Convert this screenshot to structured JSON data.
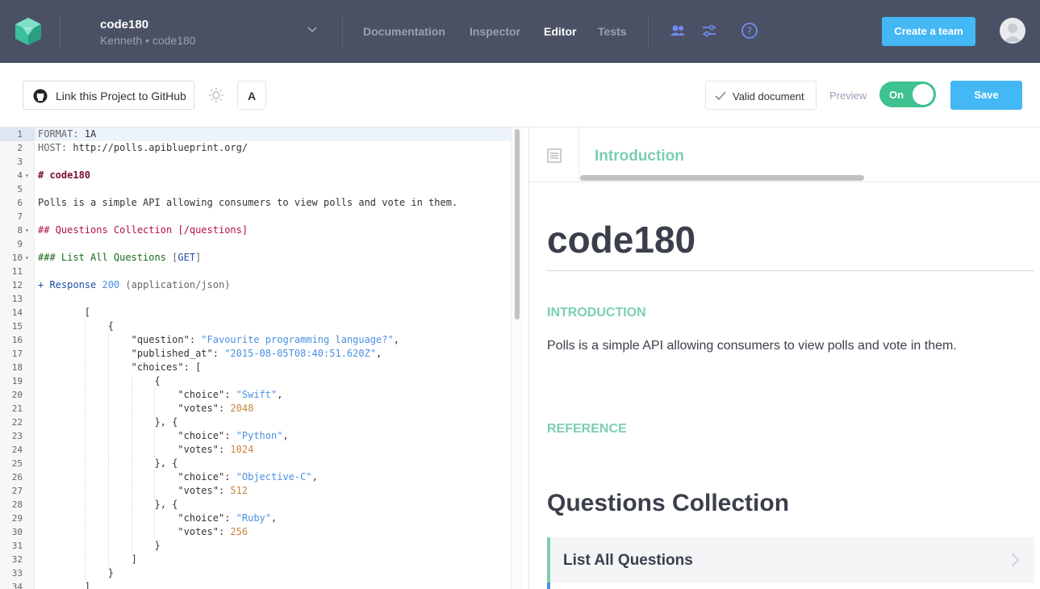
{
  "header": {
    "project_name": "code180",
    "project_sub": "Kenneth • code180",
    "nav": [
      "Documentation",
      "Inspector",
      "Editor",
      "Tests"
    ],
    "active_nav": "Editor",
    "create_team_label": "Create a team",
    "icons": [
      "team-icon",
      "settings-sliders-icon",
      "help-icon"
    ]
  },
  "toolbar": {
    "github_label": "Link this Project to GitHub",
    "font_label": "A",
    "valid_label": "Valid document",
    "preview_label": "Preview",
    "toggle_label": "On",
    "save_label": "Save"
  },
  "editor": {
    "lines": [
      {
        "n": "1",
        "fold": "",
        "parts": [
          [
            "c-gray",
            "FORMAT: "
          ],
          [
            "c-plain",
            "1A"
          ]
        ]
      },
      {
        "n": "2",
        "fold": "",
        "parts": [
          [
            "c-gray",
            "HOST: "
          ],
          [
            "c-plain",
            "http://polls.apiblueprint.org/"
          ]
        ]
      },
      {
        "n": "3",
        "fold": "",
        "parts": []
      },
      {
        "n": "4",
        "fold": "▾",
        "parts": [
          [
            "c-h1",
            "# code180"
          ]
        ]
      },
      {
        "n": "5",
        "fold": "",
        "parts": []
      },
      {
        "n": "6",
        "fold": "",
        "parts": [
          [
            "c-plain",
            "Polls is a simple API allowing consumers to view polls and vote in them."
          ]
        ]
      },
      {
        "n": "7",
        "fold": "",
        "parts": []
      },
      {
        "n": "8",
        "fold": "▾",
        "parts": [
          [
            "c-h2",
            "## Questions Collection "
          ],
          [
            "c-h2",
            "[/questions]"
          ]
        ]
      },
      {
        "n": "9",
        "fold": "",
        "parts": []
      },
      {
        "n": "10",
        "fold": "▾",
        "parts": [
          [
            "c-h3",
            "### List All Questions "
          ],
          [
            "c-gray",
            "["
          ],
          [
            "c-res",
            "GET"
          ],
          [
            "c-gray",
            "]"
          ]
        ]
      },
      {
        "n": "11",
        "fold": "",
        "parts": []
      },
      {
        "n": "12",
        "fold": "",
        "parts": [
          [
            "c-res",
            "+ Response "
          ],
          [
            "c-str",
            "200"
          ],
          [
            "c-gray",
            " (application/json)"
          ]
        ]
      },
      {
        "n": "13",
        "fold": "",
        "parts": []
      },
      {
        "n": "14",
        "fold": "",
        "parts": [
          [
            "c-plain",
            "        ["
          ]
        ]
      },
      {
        "n": "15",
        "fold": "",
        "parts": [
          [
            "c-plain",
            "            {"
          ]
        ]
      },
      {
        "n": "16",
        "fold": "",
        "parts": [
          [
            "c-key",
            "                \"question\": "
          ],
          [
            "c-str",
            "\"Favourite programming language?\""
          ],
          [
            "c-plain",
            ","
          ]
        ]
      },
      {
        "n": "17",
        "fold": "",
        "parts": [
          [
            "c-key",
            "                \"published_at\": "
          ],
          [
            "c-str",
            "\"2015-08-05T08:40:51.620Z\""
          ],
          [
            "c-plain",
            ","
          ]
        ]
      },
      {
        "n": "18",
        "fold": "",
        "parts": [
          [
            "c-key",
            "                \"choices\": ["
          ]
        ]
      },
      {
        "n": "19",
        "fold": "",
        "parts": [
          [
            "c-plain",
            "                    {"
          ]
        ]
      },
      {
        "n": "20",
        "fold": "",
        "parts": [
          [
            "c-key",
            "                        \"choice\": "
          ],
          [
            "c-str",
            "\"Swift\""
          ],
          [
            "c-plain",
            ","
          ]
        ]
      },
      {
        "n": "21",
        "fold": "",
        "parts": [
          [
            "c-key",
            "                        \"votes\": "
          ],
          [
            "c-num",
            "2048"
          ]
        ]
      },
      {
        "n": "22",
        "fold": "",
        "parts": [
          [
            "c-plain",
            "                    }, {"
          ]
        ]
      },
      {
        "n": "23",
        "fold": "",
        "parts": [
          [
            "c-key",
            "                        \"choice\": "
          ],
          [
            "c-str",
            "\"Python\""
          ],
          [
            "c-plain",
            ","
          ]
        ]
      },
      {
        "n": "24",
        "fold": "",
        "parts": [
          [
            "c-key",
            "                        \"votes\": "
          ],
          [
            "c-num",
            "1024"
          ]
        ]
      },
      {
        "n": "25",
        "fold": "",
        "parts": [
          [
            "c-plain",
            "                    }, {"
          ]
        ]
      },
      {
        "n": "26",
        "fold": "",
        "parts": [
          [
            "c-key",
            "                        \"choice\": "
          ],
          [
            "c-str",
            "\"Objective-C\""
          ],
          [
            "c-plain",
            ","
          ]
        ]
      },
      {
        "n": "27",
        "fold": "",
        "parts": [
          [
            "c-key",
            "                        \"votes\": "
          ],
          [
            "c-num",
            "512"
          ]
        ]
      },
      {
        "n": "28",
        "fold": "",
        "parts": [
          [
            "c-plain",
            "                    }, {"
          ]
        ]
      },
      {
        "n": "29",
        "fold": "",
        "parts": [
          [
            "c-key",
            "                        \"choice\": "
          ],
          [
            "c-str",
            "\"Ruby\""
          ],
          [
            "c-plain",
            ","
          ]
        ]
      },
      {
        "n": "30",
        "fold": "",
        "parts": [
          [
            "c-key",
            "                        \"votes\": "
          ],
          [
            "c-num",
            "256"
          ]
        ]
      },
      {
        "n": "31",
        "fold": "",
        "parts": [
          [
            "c-plain",
            "                    }"
          ]
        ]
      },
      {
        "n": "32",
        "fold": "",
        "parts": [
          [
            "c-plain",
            "                ]"
          ]
        ]
      },
      {
        "n": "33",
        "fold": "",
        "parts": [
          [
            "c-plain",
            "            }"
          ]
        ]
      },
      {
        "n": "34",
        "fold": "",
        "parts": [
          [
            "c-plain",
            "        ]"
          ]
        ]
      }
    ]
  },
  "preview": {
    "toc_title": "Introduction",
    "doc_title": "code180",
    "intro_label": "INTRODUCTION",
    "intro_text": "Polls is a simple API allowing consumers to view polls and vote in them.",
    "reference_label": "REFERENCE",
    "group_title": "Questions Collection",
    "action_title": "List All Questions"
  },
  "colors": {
    "topbar": "#4b5165",
    "accent_blue": "#44b8f5",
    "accent_green": "#3ec28f",
    "mint": "#7ccfb0"
  }
}
